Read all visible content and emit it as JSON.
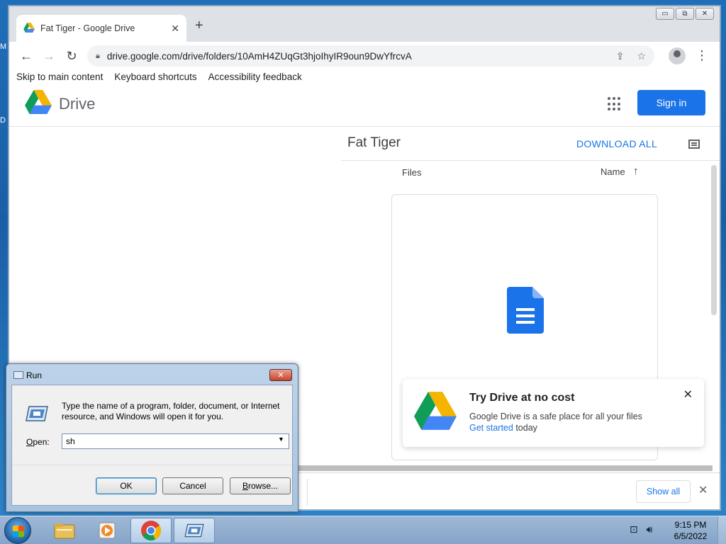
{
  "desktop": {
    "label_m": "M",
    "label_d": "D"
  },
  "browser": {
    "tab_title": "Fat Tiger - Google Drive",
    "url": "drive.google.com/drive/folders/10AmH4ZUqGt3hjoIhyIR9oun9DwYfrcvA",
    "window_controls": {
      "minimize": "▭",
      "maximize": "⧉",
      "close": "✕"
    }
  },
  "skiplinks": [
    "Skip to main content",
    "Keyboard shortcuts",
    "Accessibility feedback"
  ],
  "drive": {
    "title": "Drive",
    "signin_label": "Sign in",
    "folder_title": "Fat Tiger",
    "download_all": "DOWNLOAD ALL",
    "files_header": "Files",
    "name_header": "Name",
    "promo": {
      "title": "Try Drive at no cost",
      "description": "Google Drive is a safe place for all your files",
      "link_text": "Get started",
      "link_suffix": " today"
    },
    "downloads": {
      "show_all": "Show all"
    }
  },
  "run_dialog": {
    "title": "Run",
    "description": "Type the name of a program, folder, document, or Internet resource, and Windows will open it for you.",
    "open_label_u": "O",
    "open_label_rest": "pen:",
    "input_value": "sh",
    "ok_label": "OK",
    "cancel_label": "Cancel",
    "browse_label_u": "B",
    "browse_label_rest": "rowse..."
  },
  "taskbar": {
    "time": "9:15 PM",
    "date": "6/5/2022"
  },
  "colors": {
    "accent": "#1a73e8",
    "drive_green": "#0f9d58",
    "drive_yellow": "#f4b400",
    "drive_blue": "#4285f4",
    "drive_red": "#db4437"
  }
}
